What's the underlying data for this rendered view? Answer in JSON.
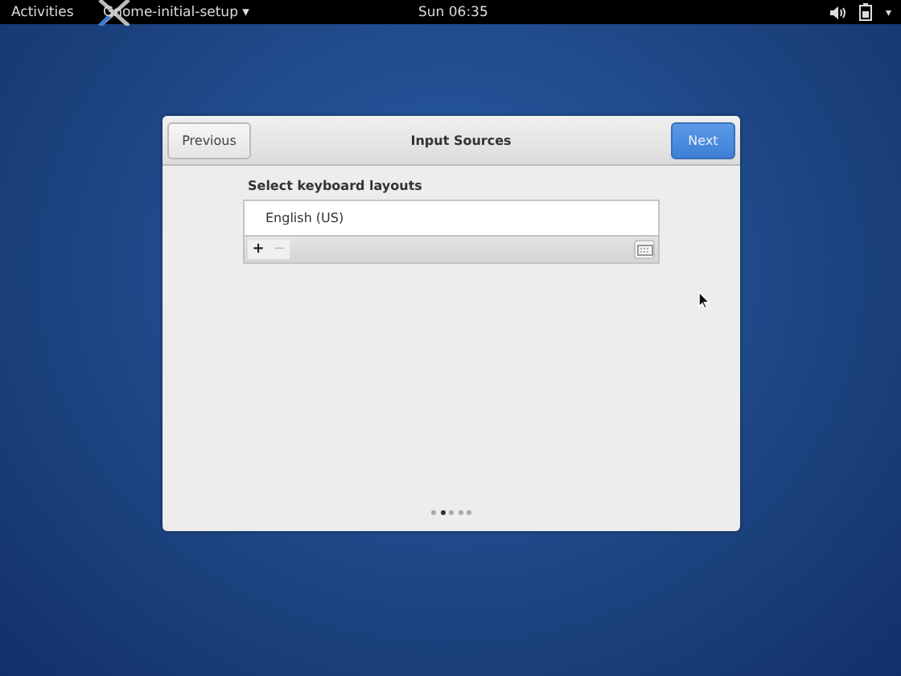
{
  "top_bar": {
    "activities": "Activities",
    "app_menu": "Gnome-initial-setup",
    "app_menu_arrow": "▾",
    "clock": "Sun 06:35",
    "status_arrow": "▾"
  },
  "dialog": {
    "title": "Input Sources",
    "previous": "Previous",
    "next": "Next",
    "section_label": "Select keyboard layouts",
    "layouts": [
      {
        "label": "English (US)"
      }
    ],
    "add_button": {
      "label": "+",
      "disabled": false
    },
    "remove_button": {
      "label": "−",
      "disabled": true
    },
    "pages": [
      {
        "selected": false
      },
      {
        "selected": true
      },
      {
        "selected": false
      },
      {
        "selected": false
      },
      {
        "selected": false
      }
    ]
  }
}
